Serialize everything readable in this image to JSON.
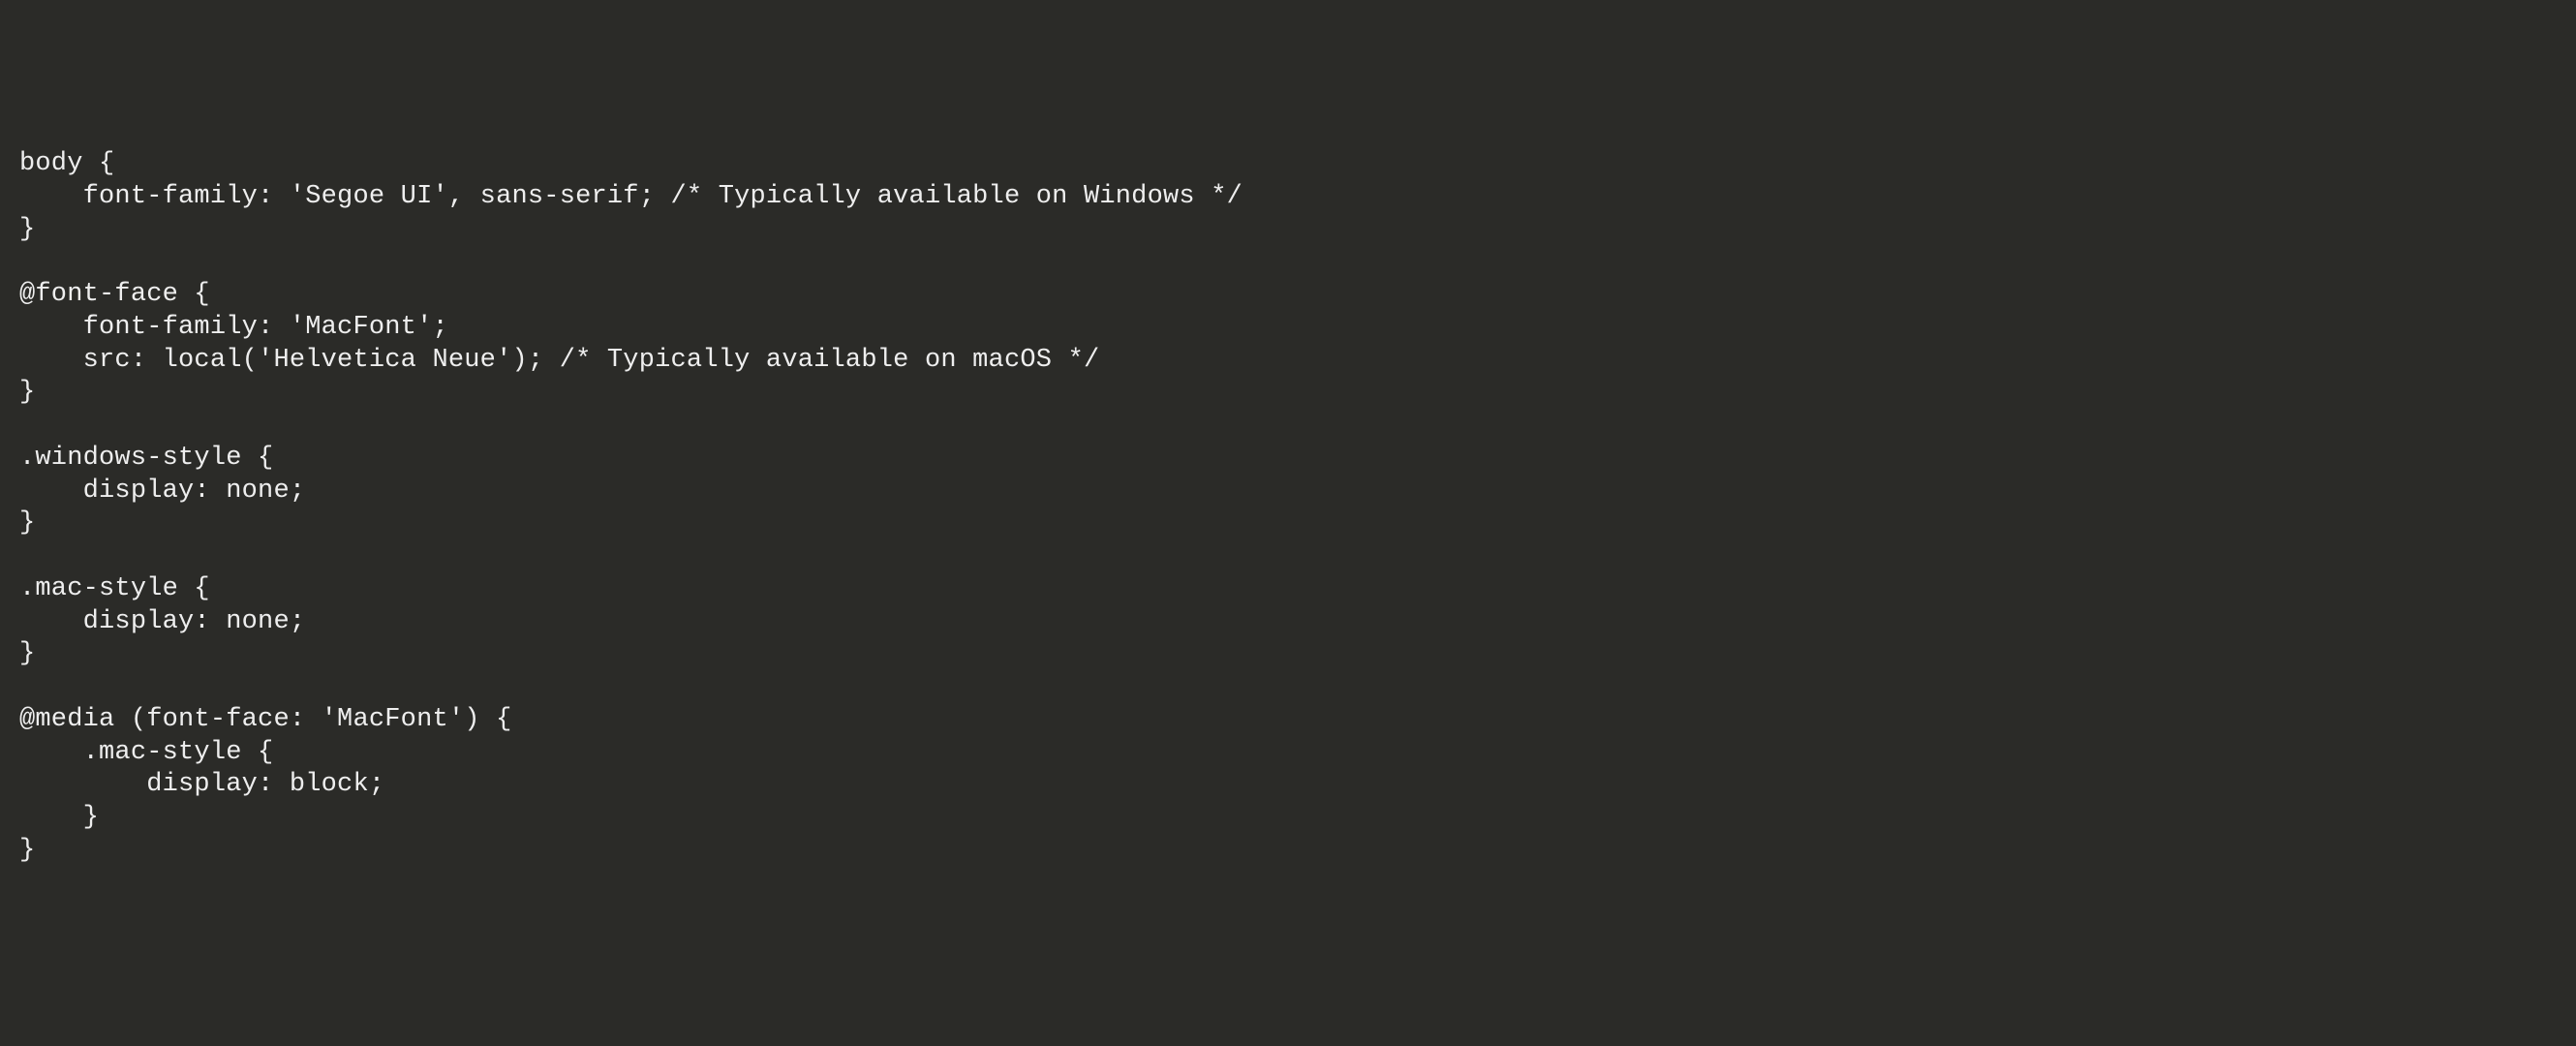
{
  "code": {
    "lines": [
      "body {",
      "    font-family: 'Segoe UI', sans-serif; /* Typically available on Windows */",
      "}",
      "",
      "@font-face {",
      "    font-family: 'MacFont';",
      "    src: local('Helvetica Neue'); /* Typically available on macOS */",
      "}",
      "",
      ".windows-style {",
      "    display: none;",
      "}",
      "",
      ".mac-style {",
      "    display: none;",
      "}",
      "",
      "@media (font-face: 'MacFont') {",
      "    .mac-style {",
      "        display: block;",
      "    }",
      "}"
    ]
  }
}
